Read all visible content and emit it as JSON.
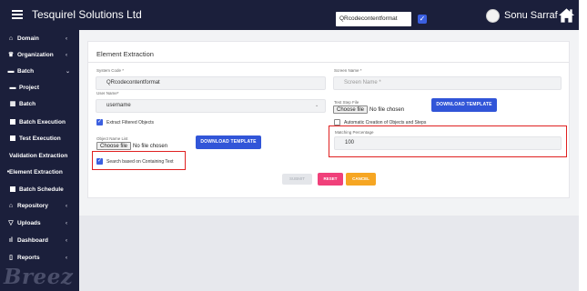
{
  "header": {
    "app_title": "Tesquirel Solutions Ltd",
    "selected_format": "QRcodecontentformat",
    "format_checked": true,
    "user_name": "Sonu Sarraf",
    "icons": {
      "menu": "hamburger-icon",
      "home": "home-icon",
      "avatar": "avatar"
    }
  },
  "sidebar": {
    "items": [
      {
        "label": "Domain",
        "icon": "bank-icon",
        "chevron": "‹"
      },
      {
        "label": "Organization",
        "icon": "trophy-icon",
        "chevron": "‹"
      },
      {
        "label": "Batch",
        "icon": "folder-icon",
        "chevron": "⌄"
      },
      {
        "label": "Project",
        "icon": "folder-icon"
      },
      {
        "label": "Batch",
        "icon": "grid-icon"
      },
      {
        "label": "Batch Execution",
        "icon": "square-icon"
      },
      {
        "label": "Test Execution",
        "icon": "square-icon"
      },
      {
        "label": "Validation Extraction"
      },
      {
        "label": "Element Extraction",
        "icon": "bullet-icon"
      },
      {
        "label": "Batch Schedule",
        "icon": "square-icon"
      },
      {
        "label": "Repository",
        "icon": "bank-icon",
        "chevron": "‹"
      },
      {
        "label": "Uploads",
        "icon": "filter-icon",
        "chevron": "‹"
      },
      {
        "label": "Dashboard",
        "icon": "bar-chart-icon",
        "chevron": "‹"
      },
      {
        "label": "Reports",
        "icon": "document-icon",
        "chevron": "‹"
      }
    ],
    "logo_text": "Breez"
  },
  "form": {
    "title": "Element Extraction",
    "system_code_label": "System Code *",
    "system_code_value": "QRcodecontentformat",
    "screen_name_label": "Screen Name *",
    "screen_name_placeholder": "Screen Name *",
    "user_name_label": "User Name*",
    "user_name_value": "username",
    "test_step_file_label": "Test Step File",
    "choose_file_button": "Choose file",
    "no_file_text": "No file chosen",
    "download_template_label": "DOWNLOAD TEMPLATE",
    "extract_filtered_label": "Extract Filtered Objects",
    "extract_filtered_checked": true,
    "auto_creation_label": "Automatic Creation of Objects and Steps",
    "auto_creation_checked": false,
    "object_name_list_label": "Object Name List",
    "matching_percentage_label": "Matching Percentage",
    "matching_percentage_value": "100",
    "search_containing_label": "Search based on Containing Text",
    "search_containing_checked": true,
    "submit_label": "SUBMIT",
    "reset_label": "RESET",
    "cancel_label": "CANCEL"
  },
  "colors": {
    "sidebar_bg": "#1b1f3b",
    "primary_blue": "#3155d8",
    "reset_pink": "#f0407a",
    "cancel_orange": "#f6a623",
    "highlight_red": "#e02020"
  }
}
